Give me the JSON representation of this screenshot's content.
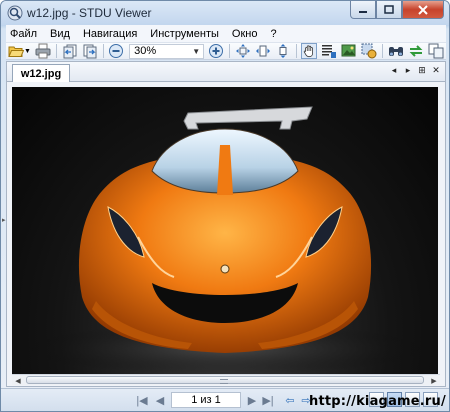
{
  "window": {
    "title": "w12.jpg - STDU Viewer",
    "controls": {
      "minimize_icon": "minimize-icon",
      "maximize_icon": "maximize-icon",
      "close_icon": "close-icon"
    }
  },
  "menu": {
    "items": [
      {
        "label": "Файл"
      },
      {
        "label": "Вид"
      },
      {
        "label": "Навигация"
      },
      {
        "label": "Инструменты"
      },
      {
        "label": "Окно"
      },
      {
        "label": "?"
      }
    ]
  },
  "toolbar": {
    "zoom_value": "30%",
    "icons": [
      "open-folder-icon",
      "print-icon",
      "page-prev-icon",
      "page-next-icon",
      "zoom-out-icon",
      "zoom-in-icon",
      "fit-page-icon",
      "fit-width-icon",
      "fit-height-icon",
      "hand-tool-icon",
      "select-text-icon",
      "select-image-icon",
      "snapshot-icon",
      "find-icon",
      "sync-icon",
      "copy-icon"
    ]
  },
  "document": {
    "tab_label": "w12.jpg",
    "image_subject": "orange-sports-car"
  },
  "statusbar": {
    "page_indicator": "1 из 1"
  },
  "watermark": "http://kiagame.ru/",
  "colors": {
    "accent": "#2f6fb8",
    "car_orange": "#f07a12",
    "viewport_bg": "#0a0a0a"
  }
}
